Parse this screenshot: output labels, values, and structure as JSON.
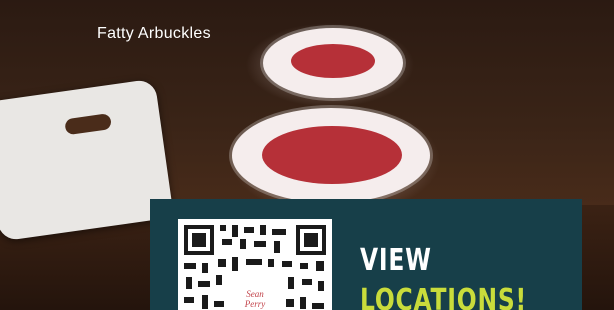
{
  "header": {
    "title": "Fatty Arbuckles"
  },
  "promo": {
    "qr_logo_text": "Sean Perry Tours",
    "cta_line1": "VIEW",
    "cta_line2": "LOCATIONS!",
    "colors": {
      "panel": "#173f49",
      "line1": "#ffffff",
      "line2": "#c9dc3b"
    }
  }
}
